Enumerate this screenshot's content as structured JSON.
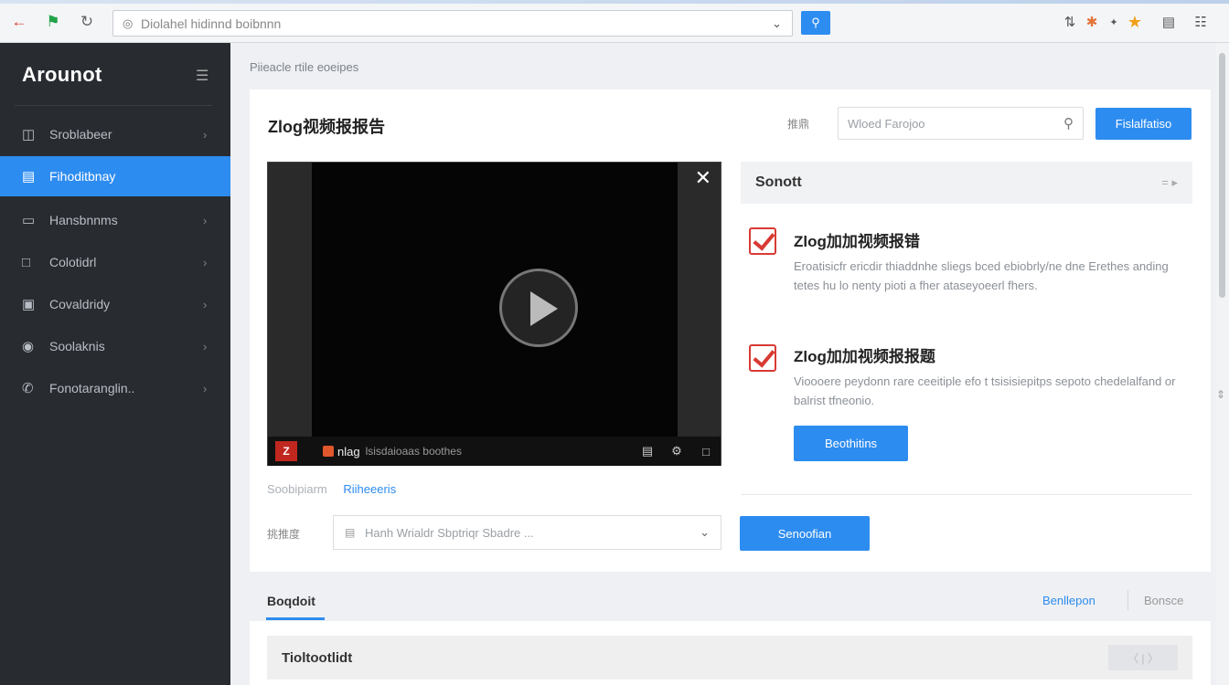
{
  "browser": {
    "address_text": "Diolahel hidinnd boibnnn",
    "toolbar_icons": [
      "back-arrow-icon",
      "flag-icon",
      "reload-icon",
      "bookmark-icon",
      "extension-icon",
      "star-icon",
      "reader-icon",
      "menu-icon"
    ],
    "colors": {
      "accent": "#2d8cf0",
      "back": "#d83a33",
      "flag": "#22a34a",
      "star": "#f0a015"
    }
  },
  "sidebar": {
    "brand": "Arounot",
    "items": [
      {
        "label": "Sroblabeer",
        "icon": "building-icon",
        "active": false
      },
      {
        "label": "Fihoditbnay",
        "icon": "store-icon",
        "active": true
      },
      {
        "label": "Hansbnnms",
        "icon": "card-icon",
        "active": false
      },
      {
        "label": "Colotidrl",
        "icon": "lock-icon",
        "active": false
      },
      {
        "label": "Covaldridy",
        "icon": "bag-icon",
        "active": false
      },
      {
        "label": "Soolaknis",
        "icon": "users-icon",
        "active": false
      },
      {
        "label": "Fonotaranglin..",
        "icon": "phone-icon",
        "active": false
      }
    ]
  },
  "main": {
    "breadcrumb": "Piieacle rtile eoeipes",
    "title": "Zlog视频报报告",
    "search_label": "推鼎",
    "search_placeholder": "Wloed Farojoo",
    "header_button": "Fislalfatiso",
    "video": {
      "channel": "nlag",
      "subtitle": "lsisdaioaas boothes",
      "logo": "Z"
    },
    "under_video": {
      "text": "Soobipiarm",
      "link": "Riiheeeris"
    },
    "select_label": "挑推度",
    "select_placeholder": "Hanh Wrialdr Sbptriqr Sbadre ...",
    "select_button": "Senoofian",
    "card": {
      "title": "Sonott",
      "controls": "= ▸",
      "items": [
        {
          "title": "Zlog加加视频报错",
          "desc": "Eroatisicfr ericdir thiaddnhe sliegs bced ebiobrly/ne dne Erethes anding tetes hu lo nenty pioti a fher ataseyoeerl fhers."
        },
        {
          "title": "Zlog加加视频报报题",
          "desc": "Vioooere peydonn rare ceeitiple efo t tsisisiepitps sepoto chedelalfand or balrist tfneonio."
        }
      ],
      "button": "Beothitins"
    }
  },
  "bottom": {
    "tab": "Boqdoit",
    "link1": "Benllepon",
    "link2": "Bonsce",
    "row_title": "Tioltootlidt",
    "pager": "〈 | 〉"
  }
}
